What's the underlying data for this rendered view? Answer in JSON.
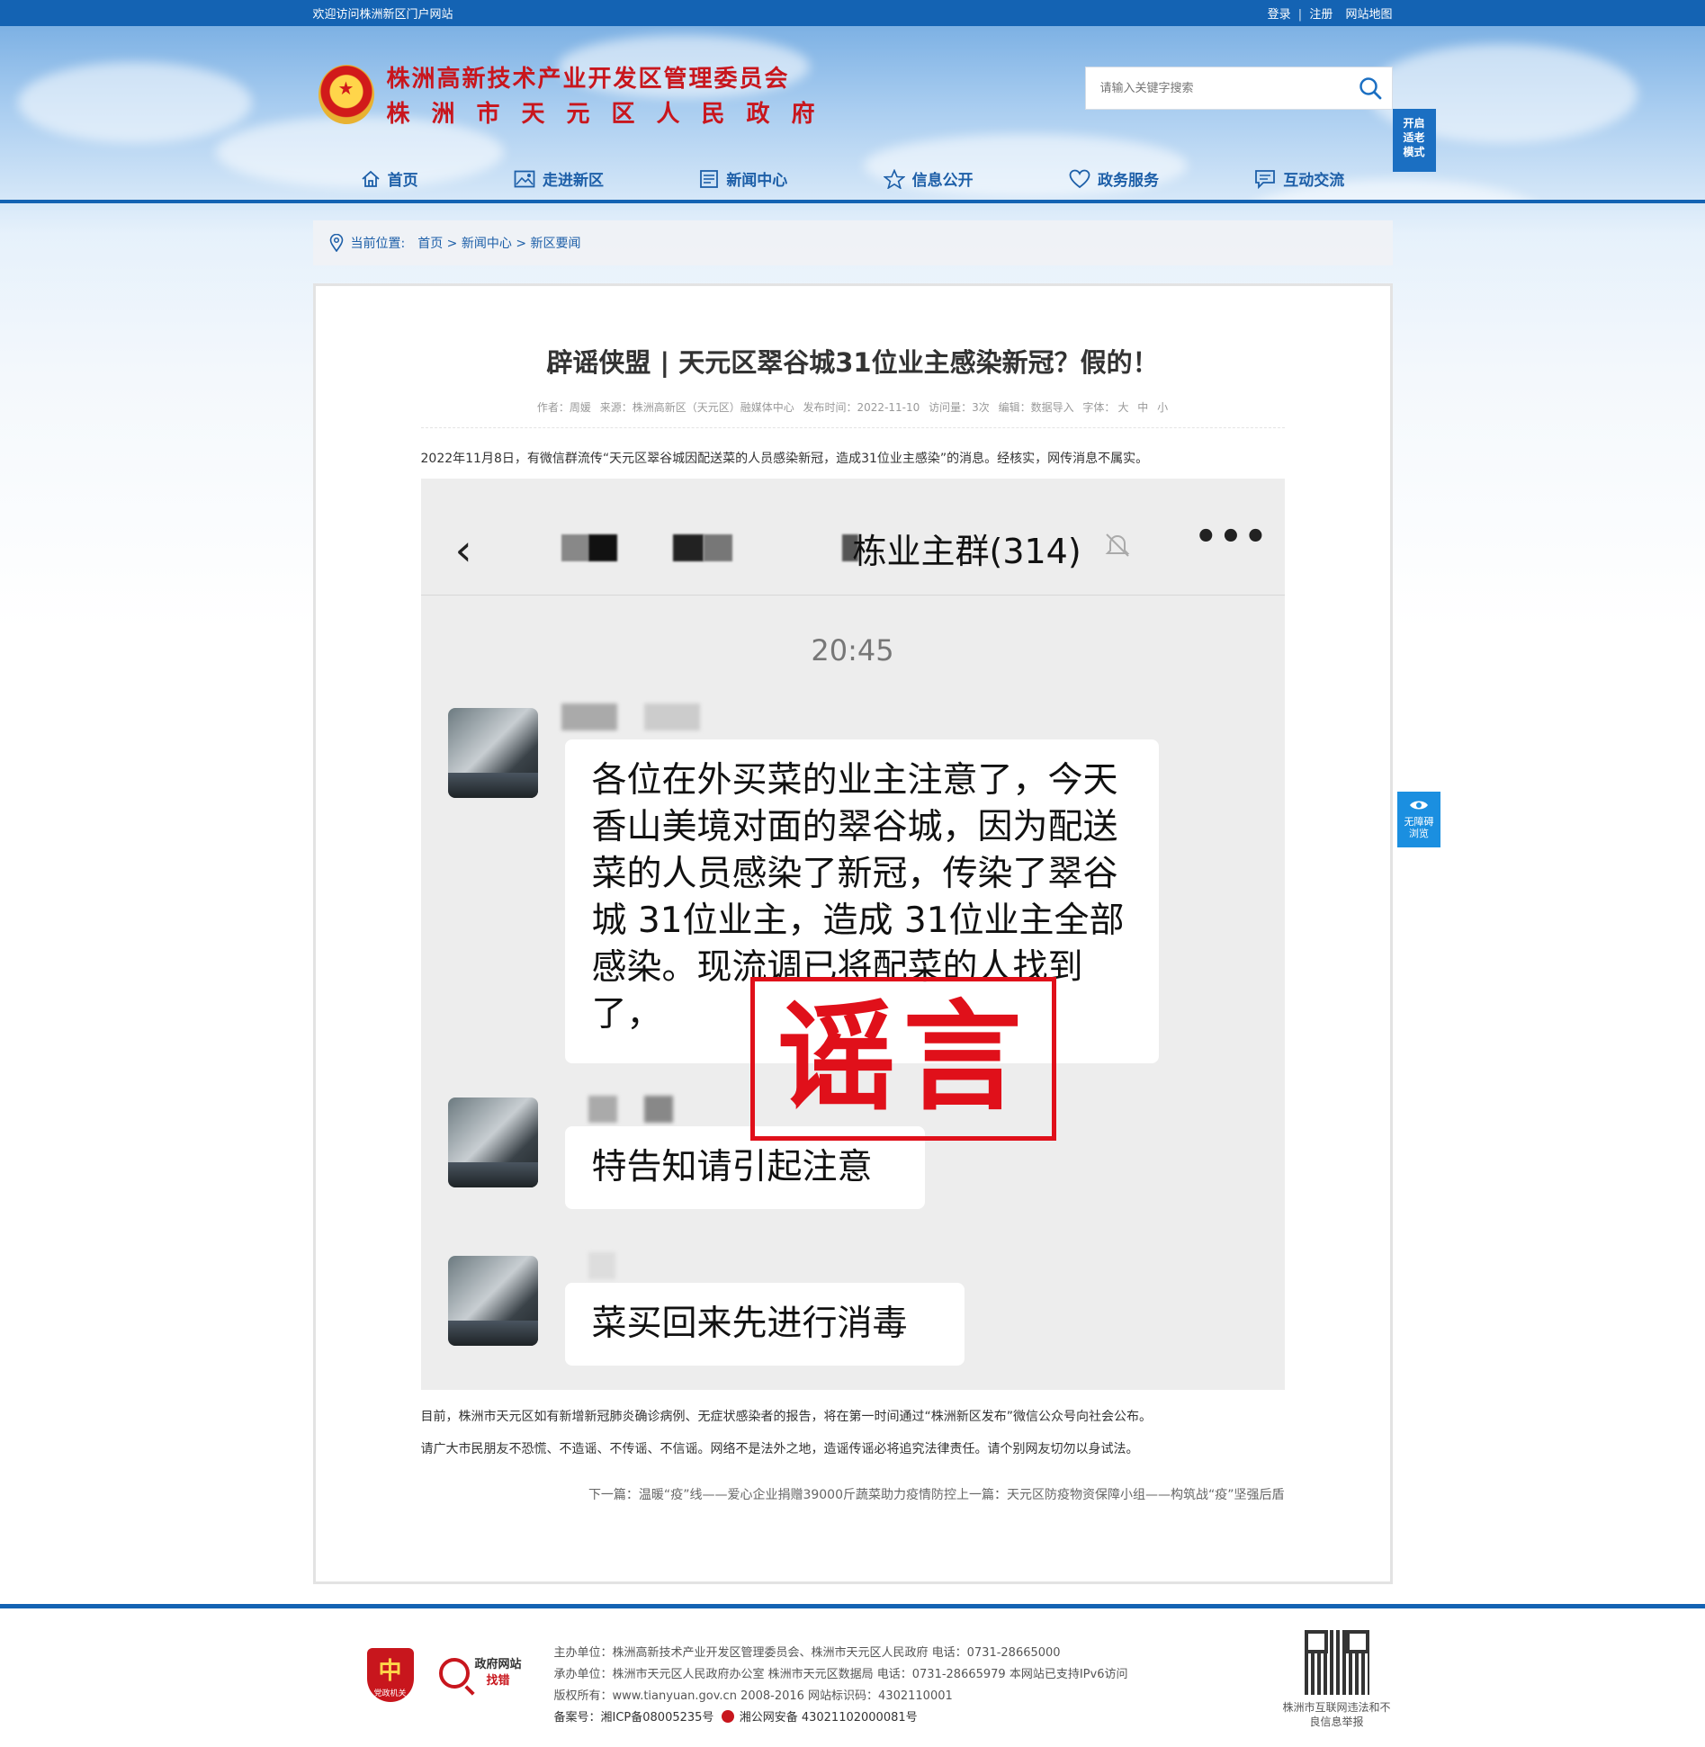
{
  "topbar": {
    "welcome": "欢迎访问株洲新区门户网站",
    "login": "登录",
    "sep": "|",
    "register": "注册",
    "sitemap": "网站地图"
  },
  "header": {
    "org_line1": "株洲高新技术产业开发区管理委员会",
    "org_line2": "株洲市天元区人民政府",
    "search_placeholder": "请输入关键字搜索",
    "elder_mode": [
      "开启",
      "适老",
      "模式"
    ]
  },
  "nav": [
    {
      "label": "首页",
      "icon": "home-icon"
    },
    {
      "label": "走进新区",
      "icon": "picture-icon"
    },
    {
      "label": "新闻中心",
      "icon": "news-icon"
    },
    {
      "label": "信息公开",
      "icon": "star-icon"
    },
    {
      "label": "政务服务",
      "icon": "heart-icon"
    },
    {
      "label": "互动交流",
      "icon": "chat-icon"
    }
  ],
  "breadcrumb": {
    "label": "当前位置:",
    "home": "首页",
    "sep": ">",
    "section": "新闻中心",
    "current": "新区要闻"
  },
  "article": {
    "title": "辟谣侠盟 | 天元区翠谷城31位业主感染新冠？假的！",
    "meta": {
      "author": "作者：周媛",
      "source": "来源：株洲高新区（天元区）融媒体中心",
      "date": "发布时间：2022-11-10",
      "views": "访问量：3次",
      "editor": "编辑：数据导入",
      "font_label": "字体：",
      "font_large": "大",
      "font_medium": "中",
      "font_small": "小"
    },
    "para1": "2022年11月8日，有微信群流传“天元区翠谷城因配送菜的人员感染新冠，造成31位业主感染”的消息。经核实，网传消息不属实。",
    "para2": "目前，株洲市天元区如有新增新冠肺炎确诊病例、无症状感染者的报告，将在第一时间通过“株洲新区发布”微信公众号向社会公布。",
    "para3": "请广大市民朋友不恐慌、不造谣、不传谣、不信谣。网络不是法外之地，造谣传谣必将追究法律责任。请个别网友切勿以身试法。",
    "next": "下一篇：温暖“疫”线——爱心企业捐赠39000斤蔬菜助力疫情防控",
    "prev": "上一篇：天元区防疫物资保障小组——构筑战“疫”坚强后盾"
  },
  "chat_image": {
    "group_name": "栋业主群(314)",
    "time": "20:45",
    "message1": "各位在外买菜的业主注意了，今天香山美境对面的翠谷城，因为配送菜的人员感染了新冠，传染了翠谷城 31位业主，造成 31位业主全部感染。现流调已将配菜的人找到了，",
    "message2": "特告知请引起注意",
    "message3": "菜买回来先进行消毒",
    "stamp": "谣言"
  },
  "a11y": {
    "label": "无障碍浏览"
  },
  "footer": {
    "host": "主办单位：株洲高新技术产业开发区管理委员会、株洲市天元区人民政府 电话：0731-28665000",
    "operator": "承办单位：株洲市天元区人民政府办公室 株洲市天元区数据局 电话：0731-28665979 本网站已支持IPv6访问",
    "copyright": "版权所有：www.tianyuan.gov.cn 2008-2016 网站标识码：4302110001",
    "record": "备案号：湘ICP备08005235号",
    "police": "湘公网安备 43021102000081号",
    "badge1_caption": "党政机关",
    "badge2_line1": "政府网站",
    "badge2_line2": "找错",
    "qr_caption": "株洲市互联网违法和不良信息举报"
  },
  "colors": {
    "brand_blue": "#1463b3",
    "title_red": "#c8161d",
    "stamp_red": "#e0101a",
    "nav_blue": "#1d5fa8"
  }
}
